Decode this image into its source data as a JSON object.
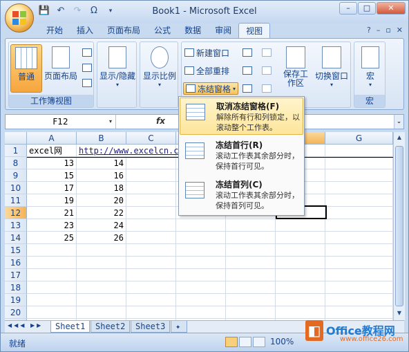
{
  "window": {
    "title": "Book1 - Microsoft Excel"
  },
  "qat": [
    "save-icon",
    "undo-icon",
    "redo-icon",
    "omega-icon"
  ],
  "tabs": [
    "开始",
    "插入",
    "页面布局",
    "公式",
    "数据",
    "审阅",
    "视图"
  ],
  "active_tab": "视图",
  "ribbon": {
    "workbook_views": {
      "label": "工作簿视图",
      "normal": "普通",
      "page_layout": "页面布局"
    },
    "show_hide": "显示/隐藏",
    "zoom": "显示比例",
    "window": {
      "new_window": "新建窗口",
      "arrange_all": "全部重排",
      "freeze_panes": "冻结窗格",
      "save_workspace": "保存工作区",
      "switch_windows": "切换窗口"
    },
    "macros": {
      "label": "宏",
      "button": "宏"
    }
  },
  "formula_bar": {
    "name_box": "F12",
    "fx": "fx"
  },
  "columns": [
    "A",
    "B",
    "C",
    "D",
    "E",
    "F",
    "G"
  ],
  "rows": [
    {
      "num": "1",
      "a": "excel网",
      "b": "http://www.excelcn.com"
    },
    {
      "num": "8",
      "a": "13",
      "b": "14"
    },
    {
      "num": "9",
      "a": "15",
      "b": "16"
    },
    {
      "num": "10",
      "a": "17",
      "b": "18"
    },
    {
      "num": "11",
      "a": "19",
      "b": "20"
    },
    {
      "num": "12",
      "a": "21",
      "b": "22"
    },
    {
      "num": "13",
      "a": "23",
      "b": "24"
    },
    {
      "num": "14",
      "a": "25",
      "b": "26"
    },
    {
      "num": "15",
      "a": "",
      "b": ""
    },
    {
      "num": "16",
      "a": "",
      "b": ""
    },
    {
      "num": "17",
      "a": "",
      "b": ""
    },
    {
      "num": "18",
      "a": "",
      "b": ""
    },
    {
      "num": "19",
      "a": "",
      "b": ""
    },
    {
      "num": "20",
      "a": "",
      "b": ""
    },
    {
      "num": "21",
      "a": "",
      "b": ""
    }
  ],
  "sheets": [
    "Sheet1",
    "Sheet2",
    "Sheet3"
  ],
  "status": {
    "ready": "就绪",
    "zoom": "100%"
  },
  "freeze_menu": [
    {
      "title": "取消冻结窗格(F)",
      "desc": "解除所有行和列锁定，以滚动整个工作表。"
    },
    {
      "title": "冻结首行(R)",
      "desc": "滚动工作表其余部分时，保持首行可见。"
    },
    {
      "title": "冻结首列(C)",
      "desc": "滚动工作表其余部分时，保持首列可见。"
    }
  ],
  "watermark": {
    "brand": "Office教程网",
    "url": "www.office26.com"
  }
}
